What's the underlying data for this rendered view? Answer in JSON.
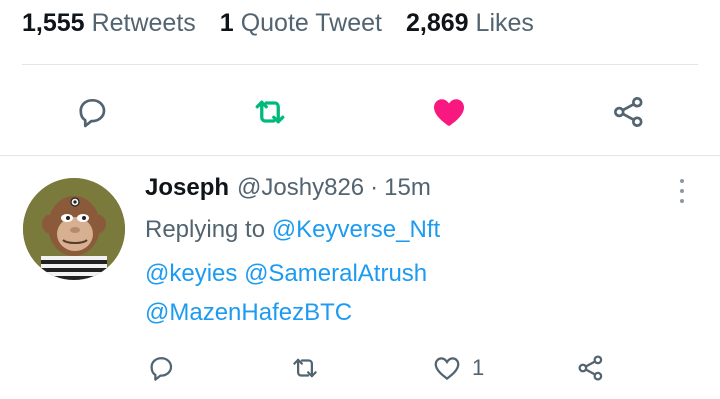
{
  "stats": {
    "retweets_count": "1,555",
    "retweets_label": "Retweets",
    "quotes_count": "1",
    "quotes_label": "Quote Tweet",
    "likes_count": "2,869",
    "likes_label": "Likes"
  },
  "action_bar": {
    "icons": [
      "reply-icon",
      "retweet-icon",
      "like-icon-filled",
      "share-icon"
    ],
    "retweet_color": "#00ba7c",
    "like_color": "#f91880",
    "icon_color": "#536471"
  },
  "reply": {
    "display_name": "Joseph",
    "handle": "@Joshy826",
    "separator": "·",
    "time": "15m",
    "replying_prefix": "Replying to",
    "mentions": [
      "@Keyverse_Nft",
      "@keyies",
      "@SameralAtrush",
      "@MazenHafezBTC"
    ],
    "like_count": "1",
    "link_color": "#1d9bf0"
  }
}
